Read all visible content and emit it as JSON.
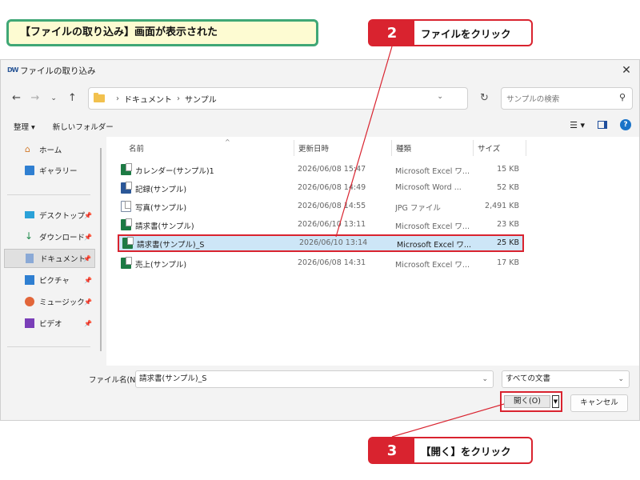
{
  "callouts": {
    "top": "【ファイルの取り込み】画面が表示された",
    "step2_num": "2",
    "step2_text": "ファイルをクリック",
    "step3_num": "3",
    "step3_text": "【開く】をクリック"
  },
  "window": {
    "app_logo": "DW",
    "title": "ファイルの取り込み"
  },
  "navbar": {
    "breadcrumb": [
      "ドキュメント",
      "サンプル"
    ],
    "search_placeholder": "サンプルの検索"
  },
  "toolbar": {
    "organize": "整理 ▾",
    "new_folder": "新しいフォルダー"
  },
  "sidebar": {
    "items": [
      {
        "label": "ホーム",
        "icon": "home-icon"
      },
      {
        "label": "ギャラリー",
        "icon": "gallery-icon"
      },
      {
        "label": "デスクトップ",
        "icon": "desktop-icon"
      },
      {
        "label": "ダウンロード",
        "icon": "download-icon"
      },
      {
        "label": "ドキュメント",
        "icon": "documents-icon"
      },
      {
        "label": "ピクチャ",
        "icon": "pictures-icon"
      },
      {
        "label": "ミュージック",
        "icon": "music-icon"
      },
      {
        "label": "ビデオ",
        "icon": "video-icon"
      }
    ]
  },
  "columns": {
    "name": "名前",
    "date": "更新日時",
    "type": "種類",
    "size": "サイズ"
  },
  "files": [
    {
      "name": "カレンダー(サンプル)1",
      "date": "2026/06/08 15:47",
      "type": "Microsoft Excel ワ...",
      "size": "15 KB",
      "kind": "excel"
    },
    {
      "name": "記録(サンプル)",
      "date": "2026/06/08 14:49",
      "type": "Microsoft Word ...",
      "size": "52 KB",
      "kind": "word"
    },
    {
      "name": "写真(サンプル)",
      "date": "2026/06/08 14:55",
      "type": "JPG ファイル",
      "size": "2,491 KB",
      "kind": "jpg"
    },
    {
      "name": "請求書(サンプル)",
      "date": "2026/06/10 13:11",
      "type": "Microsoft Excel ワ...",
      "size": "23 KB",
      "kind": "excel"
    },
    {
      "name": "請求書(サンプル)_S",
      "date": "2026/06/10 13:14",
      "type": "Microsoft Excel ワ...",
      "size": "25 KB",
      "kind": "excel"
    },
    {
      "name": "売上(サンプル)",
      "date": "2026/06/08 14:31",
      "type": "Microsoft Excel ワ...",
      "size": "17 KB",
      "kind": "excel"
    }
  ],
  "bottom": {
    "filename_label": "ファイル名(N):",
    "filename_value": "請求書(サンプル)_S",
    "filetype_value": "すべての文書",
    "open_label": "開く(O)",
    "cancel_label": "キャンセル"
  },
  "colors": {
    "accent_red": "#d9232f",
    "callout_green": "#3fa776",
    "callout_bg": "#fdfbd2",
    "selection": "#cde6f7"
  }
}
